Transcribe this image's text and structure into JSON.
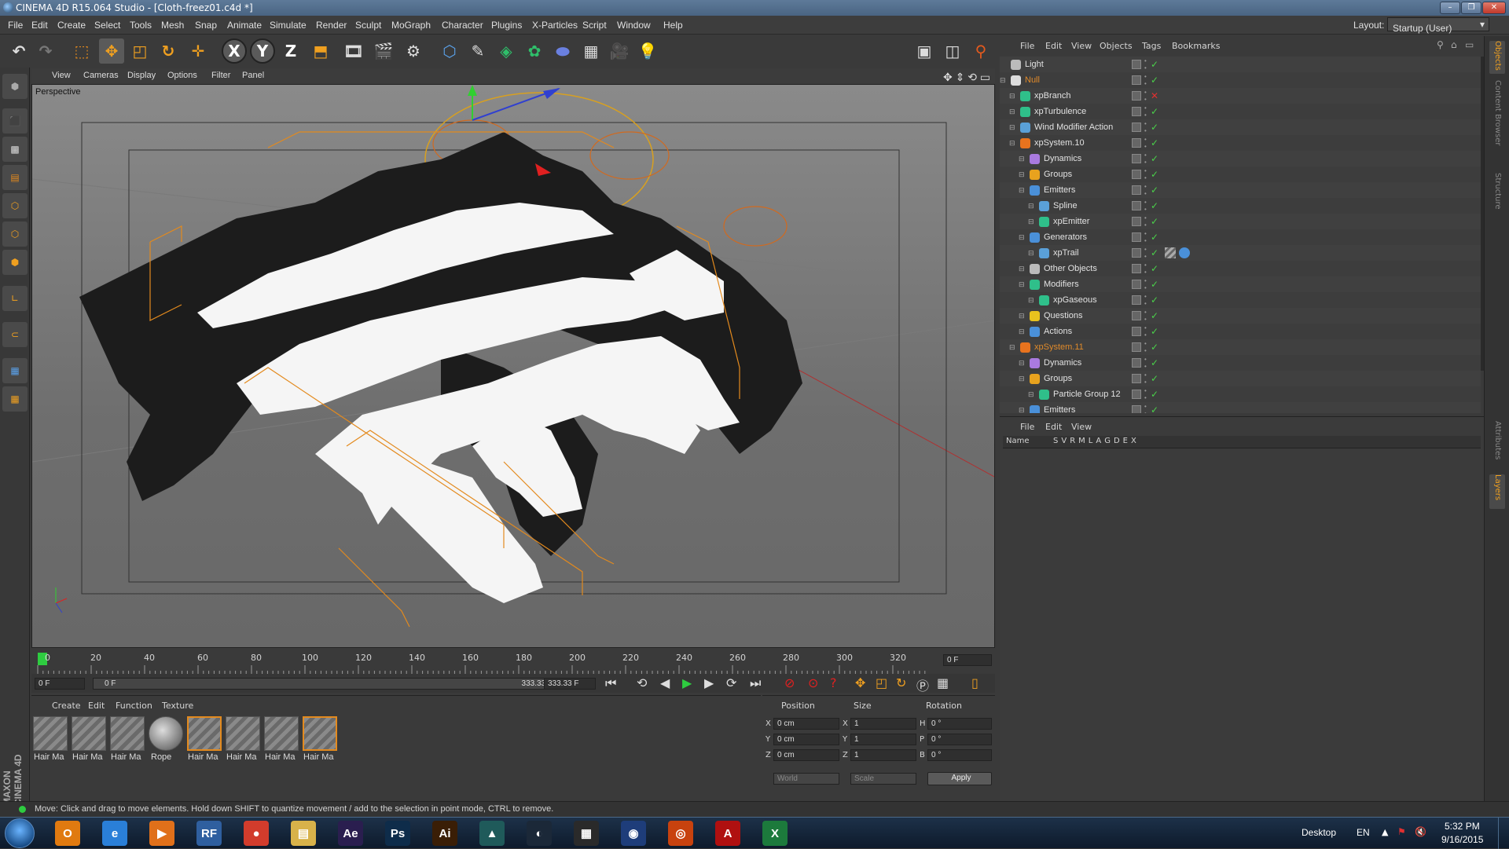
{
  "window": {
    "title": "CINEMA 4D R15.064 Studio - [Cloth-freez01.c4d *]"
  },
  "menu": [
    "File",
    "Edit",
    "Create",
    "Select",
    "Tools",
    "Mesh",
    "Snap",
    "Animate",
    "Simulate",
    "Render",
    "Sculpt",
    "MoGraph",
    "Character",
    "Plugins",
    "X-Particles",
    "Script",
    "Window",
    "Help"
  ],
  "layout": {
    "label": "Layout:",
    "value": "Startup (User)"
  },
  "viewport": {
    "menu": [
      "View",
      "Cameras",
      "Display",
      "Options",
      "Filter",
      "Panel"
    ],
    "label": "Perspective"
  },
  "timeline": {
    "ticks": [
      "0",
      "20",
      "40",
      "60",
      "80",
      "100",
      "120",
      "140",
      "160",
      "180",
      "200",
      "220",
      "240",
      "260",
      "280",
      "300",
      "320"
    ],
    "frame_right": "0 F",
    "start": "0 F",
    "slider_left": "0 F",
    "slider_right": "333.33 F",
    "end": "333.33 F"
  },
  "materials": {
    "menu": [
      "Create",
      "Edit",
      "Function",
      "Texture"
    ],
    "items": [
      "Hair Ma",
      "Hair Ma",
      "Hair Ma",
      "Rope",
      "Hair Ma",
      "Hair Ma",
      "Hair Ma",
      "Hair Ma"
    ]
  },
  "coords": {
    "headers": [
      "Position",
      "Size",
      "Rotation"
    ],
    "rows": [
      {
        "axis": "X",
        "pos": "0 cm",
        "size_axis": "X",
        "size": "1",
        "rot_axis": "H",
        "rot": "0 °"
      },
      {
        "axis": "Y",
        "pos": "0 cm",
        "size_axis": "Y",
        "size": "1",
        "rot_axis": "P",
        "rot": "0 °"
      },
      {
        "axis": "Z",
        "pos": "0 cm",
        "size_axis": "Z",
        "size": "1",
        "rot_axis": "B",
        "rot": "0 °"
      }
    ],
    "world": "World",
    "scale": "Scale",
    "apply": "Apply"
  },
  "object_manager": {
    "menu": [
      "File",
      "Edit",
      "View",
      "Objects",
      "Tags",
      "Bookmarks"
    ],
    "rows": [
      {
        "name": "Light",
        "indent": 0,
        "color": "#e2e2e2",
        "icon": "#bbbbbb"
      },
      {
        "name": "Null",
        "indent": 0,
        "color": "#e08a2a",
        "icon": "#dddddd"
      },
      {
        "name": "xpBranch",
        "indent": 1,
        "color": "#e2e2e2",
        "icon": "#2fbf8a",
        "off": true
      },
      {
        "name": "xpTurbulence",
        "indent": 1,
        "color": "#e2e2e2",
        "icon": "#2fbf8a"
      },
      {
        "name": "Wind Modifier Action",
        "indent": 1,
        "color": "#e2e2e2",
        "icon": "#5aa0d8"
      },
      {
        "name": "xpSystem.10",
        "indent": 1,
        "color": "#e2e2e2",
        "icon": "#e8731e"
      },
      {
        "name": "Dynamics",
        "indent": 2,
        "color": "#e2e2e2",
        "icon": "#a97adf"
      },
      {
        "name": "Groups",
        "indent": 2,
        "color": "#e2e2e2",
        "icon": "#e8a21e"
      },
      {
        "name": "Emitters",
        "indent": 2,
        "color": "#e2e2e2",
        "icon": "#4a90d9"
      },
      {
        "name": "Spline",
        "indent": 3,
        "color": "#e2e2e2",
        "icon": "#5aa0d8"
      },
      {
        "name": "xpEmitter",
        "indent": 3,
        "color": "#e2e2e2",
        "icon": "#2fbf8a"
      },
      {
        "name": "Generators",
        "indent": 2,
        "color": "#e2e2e2",
        "icon": "#4a90d9"
      },
      {
        "name": "xpTrail",
        "indent": 3,
        "color": "#e2e2e2",
        "icon": "#5aa0d8",
        "tags": true
      },
      {
        "name": "Other Objects",
        "indent": 2,
        "color": "#e2e2e2",
        "icon": "#bbbbbb"
      },
      {
        "name": "Modifiers",
        "indent": 2,
        "color": "#e2e2e2",
        "icon": "#2fbf8a"
      },
      {
        "name": "xpGaseous",
        "indent": 3,
        "color": "#e2e2e2",
        "icon": "#2fbf8a"
      },
      {
        "name": "Questions",
        "indent": 2,
        "color": "#e2e2e2",
        "icon": "#e8c21e"
      },
      {
        "name": "Actions",
        "indent": 2,
        "color": "#e2e2e2",
        "icon": "#4a90d9"
      },
      {
        "name": "xpSystem.11",
        "indent": 1,
        "color": "#e08a2a",
        "icon": "#e8731e"
      },
      {
        "name": "Dynamics",
        "indent": 2,
        "color": "#e2e2e2",
        "icon": "#a97adf"
      },
      {
        "name": "Groups",
        "indent": 2,
        "color": "#e2e2e2",
        "icon": "#e8a21e"
      },
      {
        "name": "Particle Group 12",
        "indent": 3,
        "color": "#e2e2e2",
        "icon": "#2fbf8a"
      },
      {
        "name": "Emitters",
        "indent": 2,
        "color": "#e2e2e2",
        "icon": "#4a90d9"
      }
    ]
  },
  "layer_manager": {
    "menu": [
      "File",
      "Edit",
      "View"
    ],
    "name_header": "Name",
    "flags": [
      "S",
      "V",
      "R",
      "M",
      "L",
      "A",
      "G",
      "D",
      "E",
      "X"
    ]
  },
  "right_tabs": [
    "Objects",
    "Content Browser",
    "Structure",
    "Attributes",
    "Layers"
  ],
  "status": "Move: Click and drag to move elements. Hold down SHIFT to quantize movement / add to the selection in point mode, CTRL to remove.",
  "brand": "MAXON CINEMA 4D",
  "taskbar": {
    "apps": [
      {
        "name": "Outlook",
        "color": "#e07a10",
        "text": "O"
      },
      {
        "name": "Internet Explorer",
        "color": "#2a7fd8",
        "text": "e"
      },
      {
        "name": "Media Player",
        "color": "#e0701a",
        "text": "▶"
      },
      {
        "name": "RealFlow",
        "color": "#2f5f9f",
        "text": "RF"
      },
      {
        "name": "Chrome",
        "color": "#d23c2c",
        "text": "●"
      },
      {
        "name": "Explorer",
        "color": "#d8b24a",
        "text": "▤"
      },
      {
        "name": "After Effects",
        "color": "#2a1e4f",
        "text": "Ae"
      },
      {
        "name": "Photoshop",
        "color": "#0e2c4a",
        "text": "Ps"
      },
      {
        "name": "Illustrator",
        "color": "#3a1e06",
        "text": "Ai"
      },
      {
        "name": "App",
        "color": "#1f5a5a",
        "text": "▲"
      },
      {
        "name": "Steam",
        "color": "#1b2838",
        "text": "◐"
      },
      {
        "name": "Tool",
        "color": "#2a2a2a",
        "text": "▦"
      },
      {
        "name": "Cinema 4D",
        "color": "#1e3d7a",
        "text": "◉"
      },
      {
        "name": "Houdini",
        "color": "#c8420e",
        "text": "◎"
      },
      {
        "name": "Acrobat",
        "color": "#b01010",
        "text": "A"
      },
      {
        "name": "Excel",
        "color": "#1c7a3c",
        "text": "X"
      }
    ],
    "desktop": "Desktop",
    "lang": "EN",
    "time": "5:32 PM",
    "date": "9/16/2015"
  }
}
